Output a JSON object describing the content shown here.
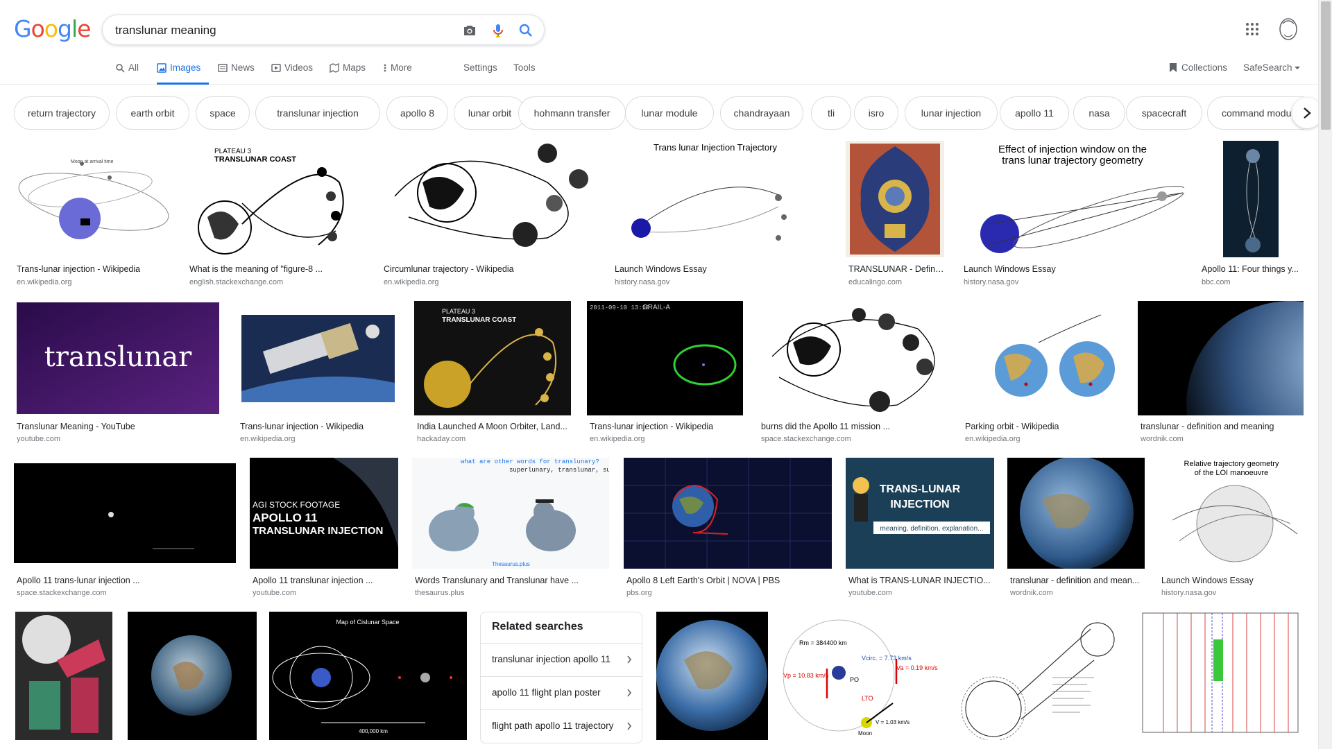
{
  "logo": {
    "text": "Google"
  },
  "search": {
    "query": "translunar meaning"
  },
  "tabs": {
    "all": "All",
    "images": "Images",
    "news": "News",
    "videos": "Videos",
    "maps": "Maps",
    "more": "More",
    "settings": "Settings",
    "tools": "Tools",
    "collections": "Collections",
    "safesearch": "SafeSearch"
  },
  "chips": [
    "return trajectory",
    "earth orbit",
    "space",
    "translunar injection",
    "apollo 8",
    "lunar orbit",
    "hohmann transfer",
    "lunar module",
    "chandrayaan",
    "tli",
    "isro",
    "lunar injection",
    "apollo 11",
    "nasa",
    "spacecraft",
    "command modul"
  ],
  "results": {
    "r0": {
      "caption": "Trans-lunar injection - Wikipedia",
      "source": "en.wikipedia.org"
    },
    "r1": {
      "caption": "What is the meaning of \"figure-8 ...",
      "source": "english.stackexchange.com"
    },
    "r2": {
      "caption": "Circumlunar trajectory - Wikipedia",
      "source": "en.wikipedia.org"
    },
    "r3": {
      "caption": "Launch Windows Essay",
      "source": "history.nasa.gov"
    },
    "r4": {
      "caption": "TRANSLUNAR - Defini...",
      "source": "educalingo.com"
    },
    "r5": {
      "caption": "Launch Windows Essay",
      "source": "history.nasa.gov"
    },
    "r6": {
      "caption": "Apollo 11: Four things y...",
      "source": "bbc.com"
    },
    "r7": {
      "caption": "Translunar Meaning - YouTube",
      "source": "youtube.com"
    },
    "r8": {
      "caption": "Trans-lunar injection - Wikipedia",
      "source": "en.wikipedia.org"
    },
    "r9": {
      "caption": "India Launched A Moon Orbiter, Land...",
      "source": "hackaday.com"
    },
    "r10": {
      "caption": "Trans-lunar injection - Wikipedia",
      "source": "en.wikipedia.org"
    },
    "r11": {
      "caption": "burns did the Apollo 11 mission ...",
      "source": "space.stackexchange.com"
    },
    "r12": {
      "caption": "Parking orbit - Wikipedia",
      "source": "en.wikipedia.org"
    },
    "r13": {
      "caption": "translunar - definition and meaning",
      "source": "wordnik.com"
    },
    "r14": {
      "caption": "Apollo 11 trans-lunar injection ...",
      "source": "space.stackexchange.com"
    },
    "r15": {
      "caption": "Apollo 11 translunar injection ...",
      "source": "youtube.com"
    },
    "r16": {
      "caption": "Words Translunary and Translunar have ...",
      "source": "thesaurus.plus"
    },
    "r17": {
      "caption": "Apollo 8 Left Earth's Orbit | NOVA | PBS",
      "source": "pbs.org"
    },
    "r18": {
      "caption": "What is TRANS-LUNAR INJECTIO...",
      "source": "youtube.com"
    },
    "r19": {
      "caption": "translunar - definition and mean...",
      "source": "wordnik.com"
    },
    "r20": {
      "caption": "Launch Windows Essay",
      "source": "history.nasa.gov"
    }
  },
  "thumb_text": {
    "tli_title": "Trans lunar Injection Trajectory",
    "effect_title_1": "Effect of injection window on the",
    "effect_title_2": "trans lunar trajectory geometry",
    "plateau_1": "PLATEAU 3",
    "plateau_2": "TRANSLUNAR COAST",
    "translunar_word": "translunar",
    "grail_label": "GRAIL-A",
    "grail_time": "2011-09-10 13:10",
    "agi_1": "AGI STOCK FOOTAGE",
    "agi_2": "APOLLO 11",
    "agi_3": "TRANSLUNAR INJECTION",
    "thes_left": "what are other words for translunary?",
    "thes_right": "superlunary, translunar, superlunar, heavenly",
    "thes_brand": "Thesaurus.plus",
    "tli_yt_1": "TRANS-LUNAR",
    "tli_yt_2": "INJECTION",
    "tli_yt_3": "meaning, definition, explanation...",
    "loi_1": "Relative trajectory geometry",
    "loi_2": "of the LOI manoeuvre",
    "cislunar_title": "Map of Cislunar Space",
    "cislunar_dist": "400,000 km",
    "vcirc": "Vcirc. = 7.73 km/s",
    "vp": "Vp = 10.83 km/s",
    "va": "Va = 0.19 km/s",
    "rm": "Rm = 384400 km",
    "v103": "V = 1.03 km/s",
    "po": "PO",
    "lto": "LTO",
    "moon": "Moon"
  },
  "related": {
    "title": "Related searches",
    "items": [
      "translunar injection apollo 11",
      "apollo 11 flight plan poster",
      "flight path apollo 11 trajectory"
    ]
  },
  "colors": {
    "accent": "#1a73e8",
    "google_blue": "#4285f4",
    "google_red": "#ea4335",
    "google_yellow": "#fbbc05",
    "google_green": "#34a853"
  }
}
